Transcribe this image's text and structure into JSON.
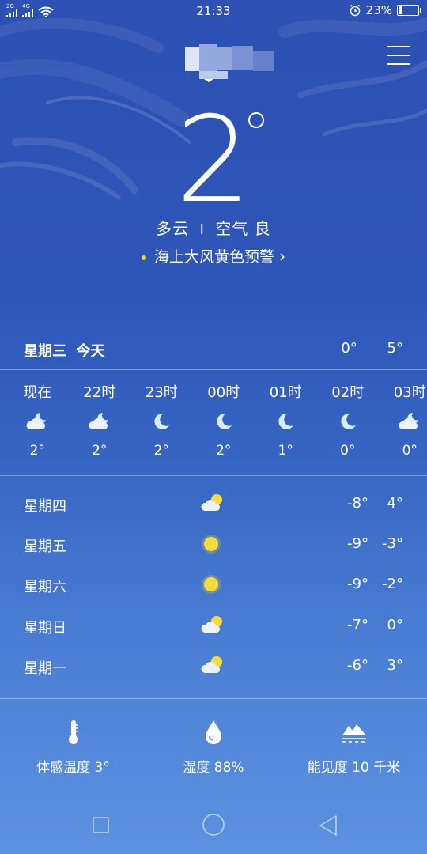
{
  "status": {
    "signal_left": "2G",
    "signal_right": "4G",
    "time": "21:33",
    "battery": "23%",
    "battery_level": 0.23
  },
  "current": {
    "temp": "2",
    "condition": "多云",
    "separator": "I",
    "air": "空气 良",
    "alert": "海上大风黄色预警"
  },
  "today": {
    "label": "星期三  今天",
    "low": "0°",
    "high": "5°"
  },
  "hourly": [
    {
      "time": "现在",
      "icon": "cloudy-night-icon",
      "temp": "2°"
    },
    {
      "time": "22时",
      "icon": "cloudy-night-icon",
      "temp": "2°"
    },
    {
      "time": "23时",
      "icon": "moon-icon",
      "temp": "2°"
    },
    {
      "time": "00时",
      "icon": "moon-icon",
      "temp": "2°"
    },
    {
      "time": "01时",
      "icon": "moon-icon",
      "temp": "1°"
    },
    {
      "time": "02时",
      "icon": "moon-icon",
      "temp": "0°"
    },
    {
      "time": "03时",
      "icon": "cloudy-night-icon",
      "temp": "0°"
    }
  ],
  "daily": [
    {
      "day": "星期四",
      "icon": "partly-cloudy-icon",
      "low": "-8°",
      "high": "4°"
    },
    {
      "day": "星期五",
      "icon": "sun-icon",
      "low": "-9°",
      "high": "-3°"
    },
    {
      "day": "星期六",
      "icon": "sun-icon",
      "low": "-9°",
      "high": "-2°"
    },
    {
      "day": "星期日",
      "icon": "partly-cloudy-icon",
      "low": "-7°",
      "high": "0°"
    },
    {
      "day": "星期一",
      "icon": "partly-cloudy-icon",
      "low": "-6°",
      "high": "3°"
    }
  ],
  "details": {
    "feels_like": "体感温度 3°",
    "humidity": "湿度 88%",
    "visibility": "能见度 10 千米"
  },
  "colors": {
    "alert_dot": "#e0dc40",
    "sun": "#f5dc3c",
    "moon": "#d6ecff"
  }
}
